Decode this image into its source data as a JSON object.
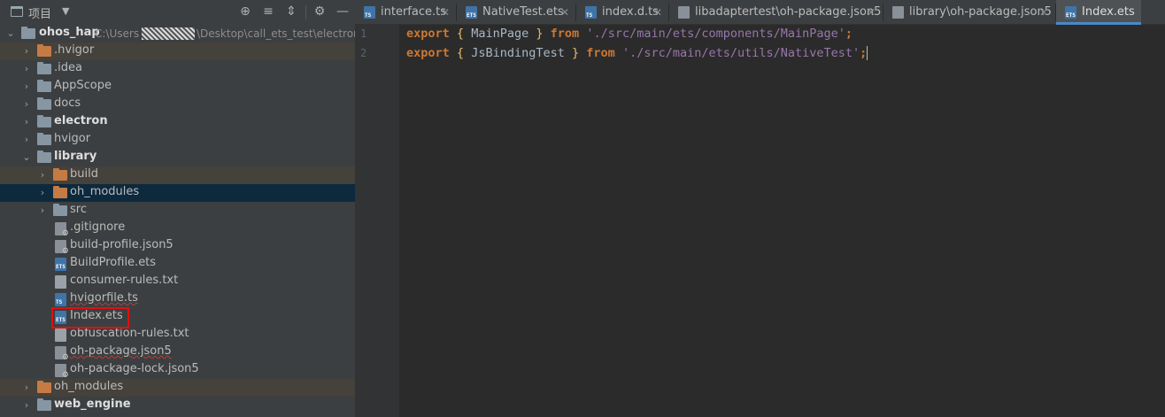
{
  "panel": {
    "title": "项目",
    "dropdown": "▼",
    "tools": [
      "⊕",
      "≡",
      "⇕",
      "⚙",
      "—"
    ]
  },
  "tree": {
    "root": {
      "name": "ohos_hap",
      "path_prefix": "C:\\Users",
      "path_suffix": "\\Desktop\\call_ets_test\\electron"
    },
    "items": [
      {
        "label": ".hvigor",
        "bold": false
      },
      {
        "label": ".idea",
        "bold": false
      },
      {
        "label": "AppScope",
        "bold": false
      },
      {
        "label": "docs",
        "bold": false
      },
      {
        "label": "electron",
        "bold": true
      },
      {
        "label": "hvigor",
        "bold": false
      },
      {
        "label": "library",
        "bold": true
      },
      {
        "label": "build",
        "bold": false
      },
      {
        "label": "oh_modules",
        "bold": false
      },
      {
        "label": "src",
        "bold": false
      },
      {
        "label": ".gitignore",
        "bold": false
      },
      {
        "label": "build-profile.json5",
        "bold": false
      },
      {
        "label": "BuildProfile.ets",
        "bold": false
      },
      {
        "label": "consumer-rules.txt",
        "bold": false
      },
      {
        "label": "hvigorfile.ts",
        "bold": false
      },
      {
        "label": "Index.ets",
        "bold": false
      },
      {
        "label": "obfuscation-rules.txt",
        "bold": false
      },
      {
        "label": "oh-package.json5",
        "bold": false
      },
      {
        "label": "oh-package-lock.json5",
        "bold": false
      },
      {
        "label": "oh_modules",
        "bold": false
      },
      {
        "label": "web_engine",
        "bold": true
      }
    ]
  },
  "tabs": [
    {
      "label": "interface.ts",
      "icon": "TS"
    },
    {
      "label": "NativeTest.ets",
      "icon": "ETS"
    },
    {
      "label": "index.d.ts",
      "icon": "TS"
    },
    {
      "label": "libadaptertest\\oh-package.json5",
      "icon": "cog"
    },
    {
      "label": "library\\oh-package.json5",
      "icon": "cog"
    },
    {
      "label": "Index.ets",
      "icon": "ETS",
      "active": true
    }
  ],
  "editor": {
    "line_numbers": [
      "1",
      "2"
    ],
    "lines": [
      {
        "kw1": "export",
        "open": "{",
        "name": "MainPage",
        "close": "}",
        "kw2": "from",
        "path": "'./src/main/ets/components/MainPage'",
        "semi": ";"
      },
      {
        "kw1": "export",
        "open": "{",
        "name": "JsBindingTest",
        "close": "}",
        "kw2": "from",
        "path": "'./src/main/ets/utils/NativeTest'",
        "semi": ";"
      }
    ]
  },
  "colors": {
    "keyword": "#cc7832",
    "string": "#9876aa",
    "brace": "#e8bf6a",
    "selection": "#0d293e",
    "highlight_box": "#e01010"
  }
}
